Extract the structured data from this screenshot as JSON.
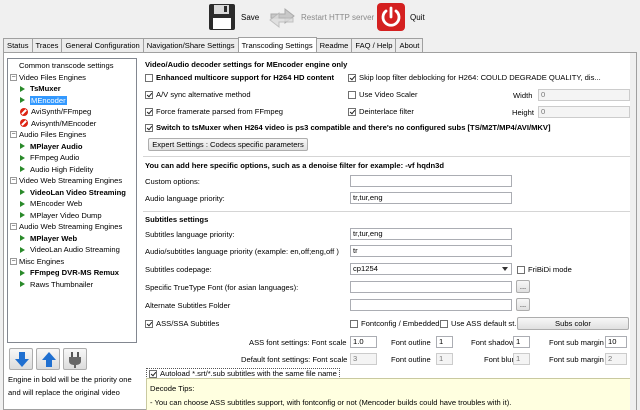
{
  "toolbar": {
    "save": "Save",
    "restart": "Restart HTTP server",
    "quit": "Quit"
  },
  "tabs": [
    "Status",
    "Traces",
    "General Configuration",
    "Navigation/Share Settings",
    "Transcoding Settings",
    "Readme",
    "FAQ / Help",
    "About"
  ],
  "tree": [
    {
      "label": "Common transcode settings",
      "level": 0,
      "kind": "leaf"
    },
    {
      "label": "Video Files Engines",
      "level": 0,
      "kind": "group"
    },
    {
      "label": "TsMuxer",
      "level": 1,
      "kind": "on",
      "bold": true
    },
    {
      "label": "MEncoder",
      "level": 1,
      "kind": "on",
      "bold": false,
      "selected": true
    },
    {
      "label": "AviSynth/FFmpeg",
      "level": 1,
      "kind": "off"
    },
    {
      "label": "Avisynth/MEncoder",
      "level": 1,
      "kind": "off"
    },
    {
      "label": "Audio Files Engines",
      "level": 0,
      "kind": "group"
    },
    {
      "label": "MPlayer Audio",
      "level": 1,
      "kind": "on",
      "bold": true
    },
    {
      "label": "FFmpeg Audio",
      "level": 1,
      "kind": "on"
    },
    {
      "label": "Audio High Fidelity",
      "level": 1,
      "kind": "on"
    },
    {
      "label": "Video Web Streaming Engines",
      "level": 0,
      "kind": "group"
    },
    {
      "label": "VideoLan Video Streaming",
      "level": 1,
      "kind": "on",
      "bold": true
    },
    {
      "label": "MEncoder Web",
      "level": 1,
      "kind": "on"
    },
    {
      "label": "MPlayer Video Dump",
      "level": 1,
      "kind": "on"
    },
    {
      "label": "Audio Web Streaming Engines",
      "level": 0,
      "kind": "group"
    },
    {
      "label": "MPlayer Web",
      "level": 1,
      "kind": "on",
      "bold": true
    },
    {
      "label": "VideoLan Audio Streaming",
      "level": 1,
      "kind": "on"
    },
    {
      "label": "Misc Engines",
      "level": 0,
      "kind": "group"
    },
    {
      "label": "FFmpeg DVR-MS Remux",
      "level": 1,
      "kind": "on",
      "bold": true
    },
    {
      "label": "Raws Thumbnailer",
      "level": 1,
      "kind": "on"
    }
  ],
  "note": [
    "Engine in bold will be the priority one",
    "and will replace the original video"
  ],
  "mencoder": {
    "heading": "Video/Audio decoder settings for MEncoder engine only",
    "multicore": "Enhanced multicore support for H264 HD content",
    "skiploop": "Skip loop filter deblocking for H264: COULD DEGRADE QUALITY, dis...",
    "avsync": "A/V sync alternative method",
    "scaler": "Use Video Scaler",
    "width_label": "Width",
    "width_val": "0",
    "forcefps": "Force framerate parsed from FFmpeg",
    "deinterlace": "Deinterlace filter",
    "height_label": "Height",
    "height_val": "0",
    "tsmuxer": "Switch to tsMuxer when H264 video is ps3 compatible and there's no configured subs [TS/M2T/MP4/AVI/MKV]",
    "expert": "Expert Settings : Codecs specific parameters",
    "options_heading": "You can add here specific options, such as a denoise filter for example: -vf hqdn3d",
    "custom_label": "Custom options:",
    "custom_val": "",
    "audio_lang_label": "Audio language priority:",
    "audio_lang_val": "tr,tur,eng"
  },
  "subs": {
    "heading": "Subtitles settings",
    "sub_lang_label": "Subtitles language priority:",
    "sub_lang_val": "tr,tur,eng",
    "as_lang_label": "Audio/subtitles language priority (example:  en,off;eng,off )",
    "as_lang_val": "tr",
    "codepage_label": "Subtitles codepage:",
    "codepage_val": "cp1254",
    "fribidi": "FriBiDi mode",
    "ttf_label": "Specific TrueType Font (for asian languages):",
    "ttf_val": "",
    "alt_folder_label": "Alternate Subtitles Folder",
    "alt_folder_val": "",
    "browse": "...",
    "ass": "ASS/SSA Subtitles",
    "fontconfig": "Fontconfig / Embedded ...",
    "use_ass_default": "Use ASS default st...",
    "subs_color": "Subs color",
    "ass_font_label": "ASS font settings: Font scale",
    "ass_scale": "1.0",
    "font_outline_label": "Font outline",
    "ass_outline": "1",
    "font_shadow_label": "Font shadow",
    "ass_shadow": "1",
    "font_margin_label": "Font sub margin",
    "ass_margin": "10",
    "def_font_label": "Default font settings: Font scale",
    "def_scale": "3",
    "def_outline": "1",
    "font_blur_label": "Font blur",
    "def_blur": "1",
    "def_margin": "2",
    "autoload": "Autoload *.srt/*.sub subtitles with the same file name"
  },
  "tips": {
    "title": "Decode Tips:",
    "line1": "- You can choose ASS subtitles support, with fontconfig or not (Mencoder builds could have troubles with it)."
  },
  "colors": {
    "accent": "#3399ff",
    "play": "#2a8a2a",
    "disabled": "#d21111",
    "arrow": "#1f6fd0",
    "tips_bg": "#ffffe0"
  }
}
